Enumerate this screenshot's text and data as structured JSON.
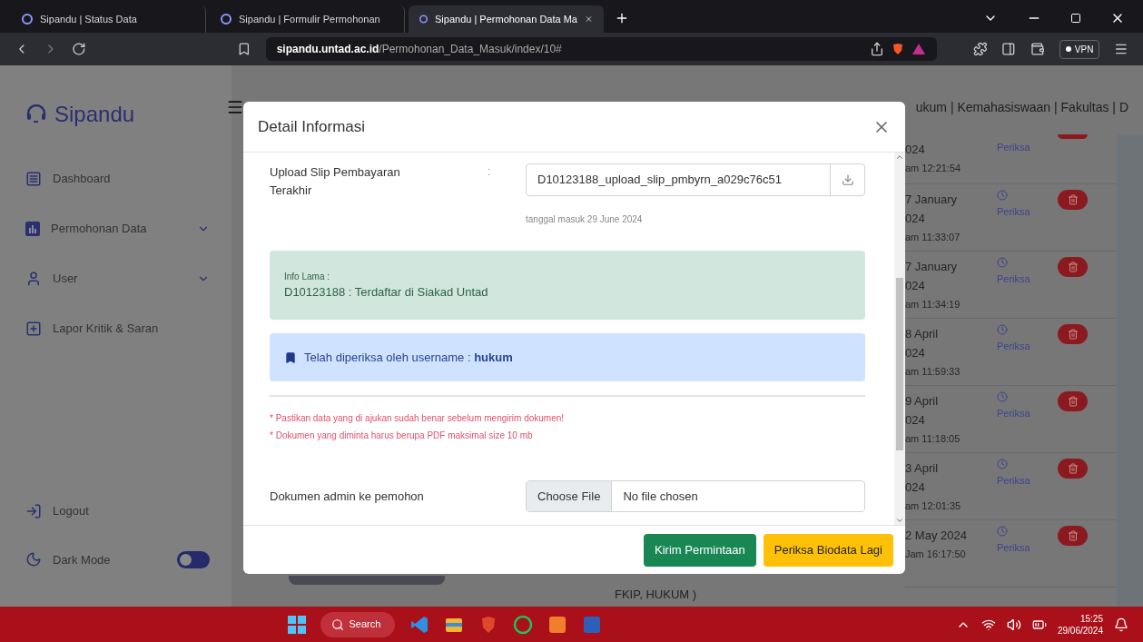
{
  "browser": {
    "tabs": [
      {
        "title": "Sipandu | Status Data",
        "selected": false
      },
      {
        "title": "Sipandu | Formulir Permohonan",
        "selected": false
      },
      {
        "title": "Sipandu | Permohonan Data Ma",
        "selected": true
      }
    ],
    "url_domain": "sipandu.untad.ac.id",
    "url_path": "/Permohonan_Data_Masuk/index/10#",
    "vpn": "VPN"
  },
  "sidebar": {
    "brand": "Sipandu",
    "items": [
      {
        "label": "Dashboard",
        "expandable": false
      },
      {
        "label": "Permohonan Data",
        "expandable": true
      },
      {
        "label": "User",
        "expandable": true
      },
      {
        "label": "Lapor Kritik & Saran",
        "expandable": false
      }
    ],
    "logout": "Logout",
    "dark_mode": {
      "label": "Dark Mode",
      "on": false
    }
  },
  "header": {
    "title_fragment": "ukum | Kemahasiswaan | Fakultas | D"
  },
  "rows": [
    {
      "kind": "partial",
      "date_lines": [
        "024",
        "am 12:21:54"
      ],
      "action": "Periksa"
    },
    {
      "kind": "full",
      "date_lines": [
        "7 January",
        "024",
        "am 11:33:07"
      ],
      "action": "Periksa"
    },
    {
      "kind": "full",
      "date_lines": [
        "7 January",
        "024",
        "am 11:34:19"
      ],
      "action": "Periksa"
    },
    {
      "kind": "full",
      "date_lines": [
        "8 April",
        "024",
        "am 11:59:33"
      ],
      "action": "Periksa"
    },
    {
      "kind": "full",
      "date_lines": [
        "9 April",
        "024",
        "am 11:18:05"
      ],
      "action": "Periksa"
    },
    {
      "kind": "full",
      "date_lines": [
        "3 April",
        "024",
        "am 12:01:35"
      ],
      "action": "Periksa"
    },
    {
      "kind": "full",
      "date_lines": [
        "2 May 2024",
        "Jam 16:17:50"
      ],
      "action": "Periksa"
    }
  ],
  "background_fragment": "FKIP, HUKUM )",
  "modal": {
    "title": "Detail Informasi",
    "upload": {
      "label": "Upload Slip Pembayaran Terakhir",
      "colon": ":",
      "value": "D10123188_upload_slip_pmbyrn_a029c76c51",
      "note": "tanggal masuk 29 June 2024"
    },
    "info": {
      "label": "Info Lama :",
      "text": "D10123188 : Terdaftar di Siakad Untad"
    },
    "checked_by": "Telah diperiksa oleh username : **hukum**",
    "notes": [
      "* Pastikan data yang di ajukan sudah benar sebelum mengirim dokumen!",
      "* Dokumen yang diminta harus berupa PDF maksimal size 10 mb"
    ],
    "file": {
      "label": "Dokumen admin ke pemohon",
      "button": "Choose File",
      "status": "No file chosen"
    },
    "buttons": [
      {
        "label": "Kirim Permintaan",
        "kind": "success"
      },
      {
        "label": "Periksa Biodata Lagi",
        "kind": "warning"
      }
    ]
  },
  "taskbar": {
    "search": "Search",
    "time": "15:25",
    "date": "29/06/2024"
  }
}
